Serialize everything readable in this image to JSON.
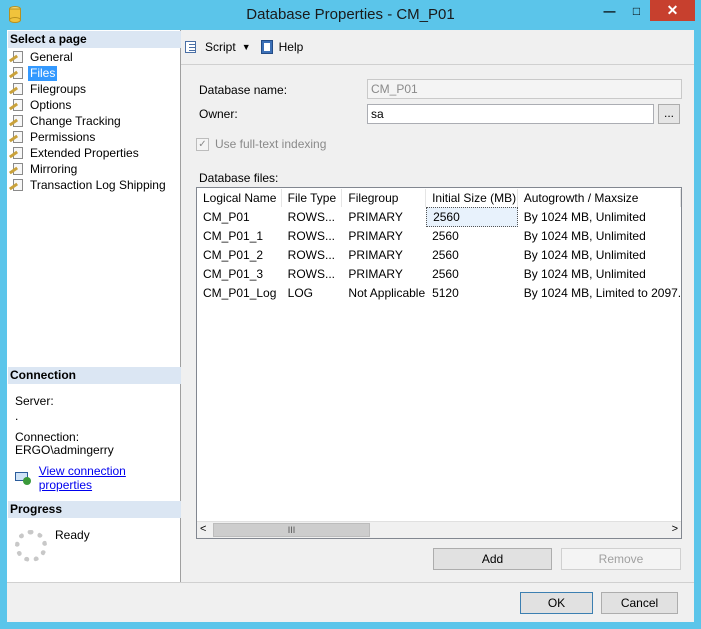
{
  "window": {
    "title": "Database Properties - CM_P01",
    "minimize": "—",
    "maximize": "□",
    "close": "✕"
  },
  "sidebar": {
    "select_page_header": "Select a page",
    "items": [
      {
        "label": "General"
      },
      {
        "label": "Files",
        "selected": true
      },
      {
        "label": "Filegroups"
      },
      {
        "label": "Options"
      },
      {
        "label": "Change Tracking"
      },
      {
        "label": "Permissions"
      },
      {
        "label": "Extended Properties"
      },
      {
        "label": "Mirroring"
      },
      {
        "label": "Transaction Log Shipping"
      }
    ],
    "connection_header": "Connection",
    "server_label": "Server:",
    "server_value": ".",
    "connection_label": "Connection:",
    "connection_value": "ERGO\\admingerry",
    "view_connection_link": "View connection properties",
    "progress_header": "Progress",
    "progress_status": "Ready"
  },
  "toolbar": {
    "script_label": "Script",
    "help_label": "Help"
  },
  "form": {
    "database_name_label": "Database name:",
    "database_name_value": "CM_P01",
    "owner_label": "Owner:",
    "owner_value": "sa",
    "browse_label": "...",
    "fulltext_label": "Use full-text indexing",
    "fulltext_checked": true,
    "database_files_label": "Database files:"
  },
  "grid": {
    "columns": [
      "Logical Name",
      "File Type",
      "Filegroup",
      "Initial Size (MB)",
      "Autogrowth / Maxsize"
    ],
    "rows": [
      [
        "CM_P01",
        "ROWS...",
        "PRIMARY",
        "2560",
        "By 1024 MB, Unlimited"
      ],
      [
        "CM_P01_1",
        "ROWS...",
        "PRIMARY",
        "2560",
        "By 1024 MB, Unlimited"
      ],
      [
        "CM_P01_2",
        "ROWS...",
        "PRIMARY",
        "2560",
        "By 1024 MB, Unlimited"
      ],
      [
        "CM_P01_3",
        "ROWS...",
        "PRIMARY",
        "2560",
        "By 1024 MB, Unlimited"
      ],
      [
        "CM_P01_Log",
        "LOG",
        "Not Applicable",
        "5120",
        "By 1024 MB, Limited to 2097..."
      ]
    ],
    "scroll_left": "<",
    "scroll_right": ">",
    "scroll_thumb": "III"
  },
  "buttons": {
    "add": "Add",
    "remove": "Remove",
    "ok": "OK",
    "cancel": "Cancel"
  }
}
